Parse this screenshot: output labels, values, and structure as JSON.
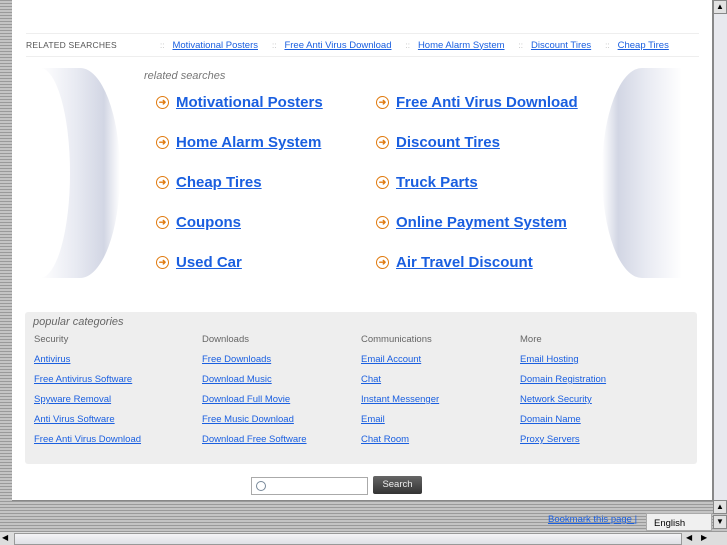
{
  "top_bar": {
    "label": "RELATED SEARCHES",
    "links": [
      "Motivational Posters",
      "Free Anti Virus Download",
      "Home Alarm System",
      "Discount Tires",
      "Cheap Tires"
    ]
  },
  "related": {
    "title": "related searches",
    "links": [
      "Motivational Posters",
      "Free Anti Virus Download",
      "Home Alarm System",
      "Discount Tires",
      "Cheap Tires",
      "Truck Parts",
      "Coupons",
      "Online Payment System",
      "Used Car",
      "Air Travel Discount"
    ]
  },
  "popular": {
    "title": "popular categories",
    "columns": [
      {
        "header": "Security",
        "links": [
          "Antivirus",
          "Free Antivirus Software",
          "Spyware Removal",
          "Anti Virus Software",
          "Free Anti Virus Download"
        ]
      },
      {
        "header": "Downloads",
        "links": [
          "Free Downloads",
          "Download Music",
          "Download Full Movie",
          "Free Music Download",
          "Download Free Software"
        ]
      },
      {
        "header": "Communications",
        "links": [
          "Email Account",
          "Chat",
          "Instant Messenger",
          "Email",
          "Chat Room"
        ]
      },
      {
        "header": "More",
        "links": [
          "Email Hosting",
          "Domain Registration",
          "Network Security",
          "Domain Name",
          "Proxy Servers"
        ]
      }
    ]
  },
  "search": {
    "value": "",
    "button": "Search"
  },
  "footer": {
    "bookmark": "Bookmark this page |",
    "language": "English"
  },
  "colors": {
    "link": "#1a5fe0",
    "arrow": "#e07b10"
  }
}
